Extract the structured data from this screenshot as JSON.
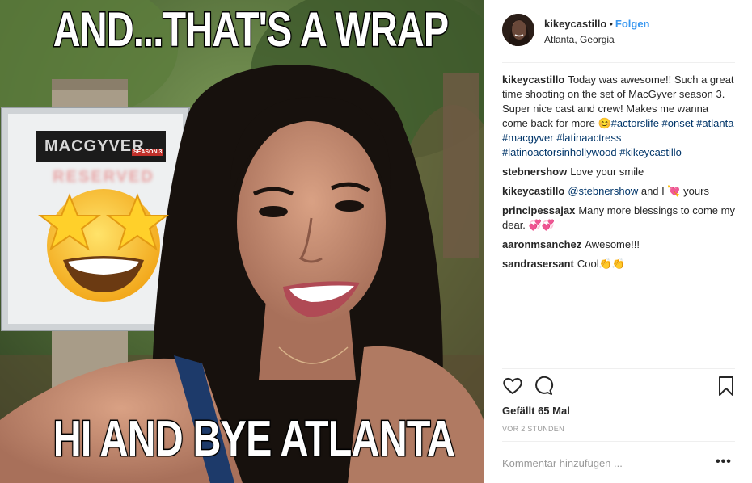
{
  "photo": {
    "caption_top": "AND...THAT'S A WRAP",
    "caption_bottom": "HI AND BYE ATLANTA",
    "sign_logo": "MACGYVER",
    "sign_season": "SEASON 3",
    "sign_text": "RESERVED",
    "emoji": "star-struck-emoji"
  },
  "header": {
    "username": "kikeycastillo",
    "separator": "•",
    "follow_label": "Folgen",
    "location": "Atlanta, Georgia"
  },
  "comments": [
    {
      "user": "kikeycastillo",
      "text": "Today was awesome!! Such a great time shooting on the set of MacGyver season 3. Super nice cast and crew! Makes me wanna come back for more 😊",
      "hashtags": "#actorslife #onset #atlanta #macgyver #latinaactress #latinoactorsinhollywood #kikeycastillo"
    },
    {
      "user": "stebnershow",
      "text": "Love your smile"
    },
    {
      "user": "kikeycastillo",
      "mention": "@stebnershow",
      "text": " and I 💘 yours"
    },
    {
      "user": "principessajax",
      "text": "Many more blessings to come my dear. 💞💞"
    },
    {
      "user": "aaronmsanchez",
      "text": "Awesome!!!"
    },
    {
      "user": "sandrasersant",
      "text": "Cool👏👏"
    }
  ],
  "actions": {
    "like_icon": "heart-icon",
    "comment_icon": "comment-bubble-icon",
    "save_icon": "bookmark-icon"
  },
  "likes": "Gefällt 65 Mal",
  "timestamp": "VOR 2 STUNDEN",
  "add_comment": {
    "placeholder": "Kommentar hinzufügen ...",
    "value": ""
  },
  "more_label": "•••",
  "colors": {
    "link": "#3897f0",
    "hashtag": "#003569",
    "text": "#262626",
    "muted": "#999999",
    "divider": "#efefef"
  }
}
